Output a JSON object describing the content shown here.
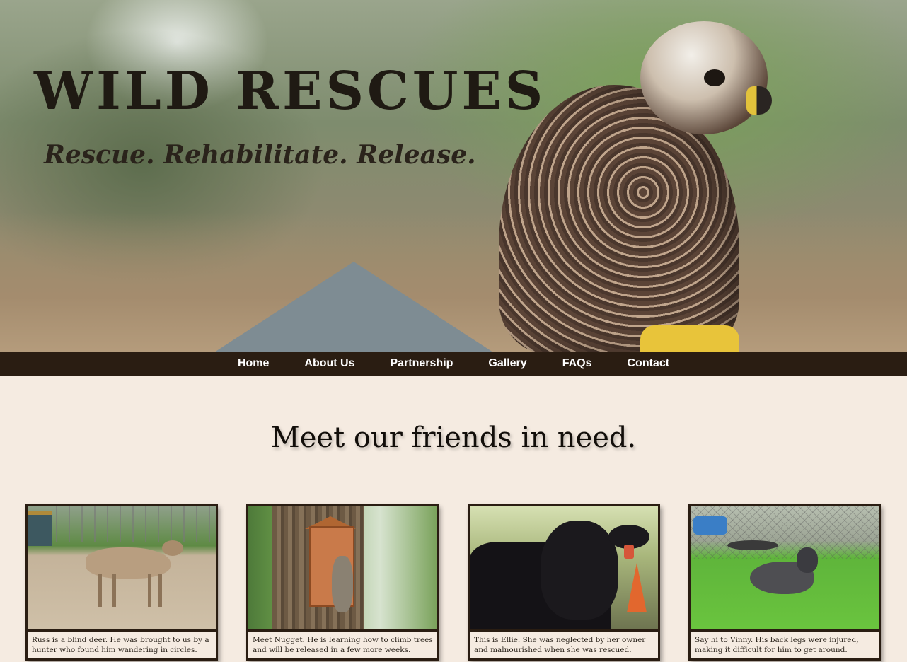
{
  "hero": {
    "title": "WILD RESCUES",
    "tagline": "Rescue. Rehabilitate. Release."
  },
  "nav": {
    "items": [
      {
        "label": "Home"
      },
      {
        "label": "About Us"
      },
      {
        "label": "Partnership"
      },
      {
        "label": "Gallery"
      },
      {
        "label": "FAQs"
      },
      {
        "label": "Contact"
      }
    ]
  },
  "main": {
    "heading": "Meet our friends in need.",
    "cards": [
      {
        "caption": "Russ is a blind deer. He was brought to us by a hunter who found him wandering in circles."
      },
      {
        "caption": "Meet Nugget. He is learning how to climb trees and will be released in a few more weeks."
      },
      {
        "caption": "This is Ellie. She was neglected by her owner and malnourished when she was rescued."
      },
      {
        "caption": "Say hi to Vinny. His back legs were injured, making it difficult for him to get around."
      }
    ]
  },
  "colors": {
    "page_background": "#f5ebe1",
    "nav_background": "#2a1d12",
    "nav_text": "#ffffff",
    "title_text": "#1f1a13"
  }
}
